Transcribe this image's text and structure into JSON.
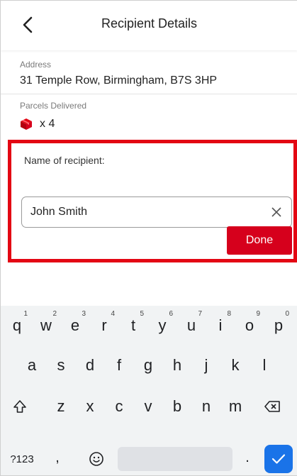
{
  "header": {
    "title": "Recipient Details",
    "back_icon": "chevron-left-icon"
  },
  "address": {
    "label": "Address",
    "value": "31 Temple Row, Birmingham, B7S 3HP"
  },
  "parcels": {
    "label": "Parcels Delivered",
    "icon": "parcel-box-icon",
    "count": "x 4"
  },
  "recipient": {
    "label": "Name of recipient:",
    "value": "John Smith",
    "clear_icon": "close-icon",
    "done_label": "Done"
  },
  "keyboard": {
    "row1": [
      {
        "key": "q",
        "hint": "1"
      },
      {
        "key": "w",
        "hint": "2"
      },
      {
        "key": "e",
        "hint": "3"
      },
      {
        "key": "r",
        "hint": "4"
      },
      {
        "key": "t",
        "hint": "5"
      },
      {
        "key": "y",
        "hint": "6"
      },
      {
        "key": "u",
        "hint": "7"
      },
      {
        "key": "i",
        "hint": "8"
      },
      {
        "key": "o",
        "hint": "9"
      },
      {
        "key": "p",
        "hint": "0"
      }
    ],
    "row2": [
      "a",
      "s",
      "d",
      "f",
      "g",
      "h",
      "j",
      "k",
      "l"
    ],
    "row3": [
      "z",
      "x",
      "c",
      "v",
      "b",
      "n",
      "m"
    ],
    "symbols_label": "?123",
    "comma": ",",
    "period": ".",
    "emoji_icon": "smiley-icon",
    "shift_icon": "shift-icon",
    "backspace_icon": "backspace-icon",
    "enter_icon": "checkmark-icon"
  },
  "colors": {
    "accent_red": "#d6001c",
    "highlight_red": "#e30613",
    "keyboard_bg": "#f1f3f4",
    "enter_blue": "#1a73e8"
  }
}
